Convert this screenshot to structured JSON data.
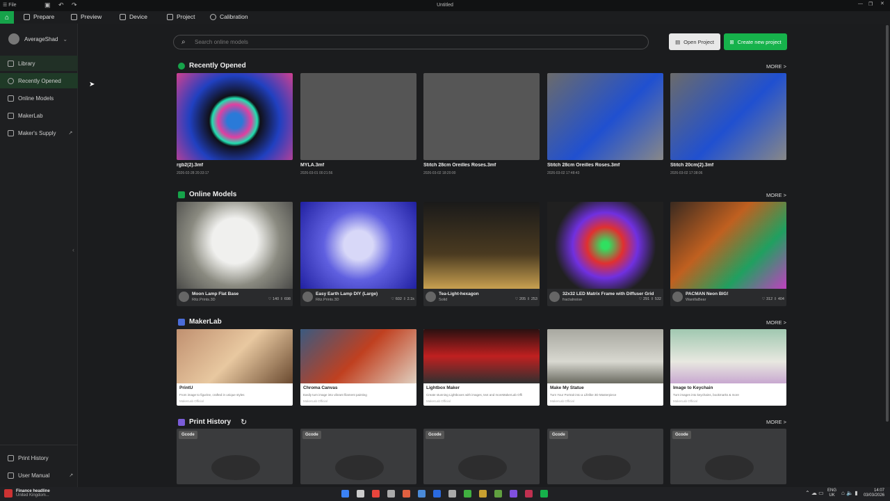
{
  "window": {
    "title": "Untitled",
    "file_menu": "File"
  },
  "menu": {
    "prepare": "Prepare",
    "preview": "Preview",
    "device": "Device",
    "project": "Project",
    "calibration": "Calibration"
  },
  "sidebar": {
    "user": "AverageShad",
    "items": [
      "Library",
      "Recently Opened",
      "Online Models",
      "MakerLab",
      "Maker's Supply"
    ],
    "bottom": [
      "Print History",
      "User Manual"
    ]
  },
  "search": {
    "placeholder": "Search online models"
  },
  "buttons": {
    "open": "Open Project",
    "create": "Create new project"
  },
  "recent": {
    "title": "Recently Opened",
    "more": "MORE >",
    "items": [
      {
        "name": "rgb2(2).3mf",
        "date": "2026-02-28 20:33:17"
      },
      {
        "name": "MYLA.3mf",
        "date": "2026-03-01 00:21:56"
      },
      {
        "name": "Stitch 28cm Oreilles Roses.3mf",
        "date": "2026-03-02 18:20:00"
      },
      {
        "name": "Stitch 28cm Oreilles Roses.3mf",
        "date": "2026-03-02 17:48:43"
      },
      {
        "name": "Stitch 20cm(2).3mf",
        "date": "2026-03-02 17:38:06"
      }
    ]
  },
  "online": {
    "title": "Online Models",
    "more": "MORE >",
    "items": [
      {
        "name": "Moon Lamp Flat Base",
        "author": "Ritz.Prints.3D",
        "likes": "140",
        "dl": "698"
      },
      {
        "name": "Easy Earth Lamp DIY (Large)",
        "author": "Ritz.Prints.3D",
        "likes": "602",
        "dl": "2.1k"
      },
      {
        "name": "Tea-Light-hexagon",
        "author": "Solid",
        "likes": "205",
        "dl": "253"
      },
      {
        "name": "32x32 LED Matrix Frame with Diffuser Grid",
        "author": "fractalnoise",
        "likes": "291",
        "dl": "532"
      },
      {
        "name": "PACMAN Neon BIG!",
        "author": "WanillaBear",
        "likes": "312",
        "dl": "404"
      }
    ]
  },
  "makerlab": {
    "title": "MakerLab",
    "more": "MORE >",
    "items": [
      {
        "name": "PrintU",
        "desc": "From image to figurine, crafted in unique styles",
        "author": "MakerLab Official"
      },
      {
        "name": "Chroma Canvas",
        "desc": "Easily turn image into vibrant filament painting",
        "author": "MakerLab Official"
      },
      {
        "name": "Lightbox Maker",
        "desc": "Create stunning Lightboxes with images, text and moreMakerLab Offi",
        "author": "MakerLab Official"
      },
      {
        "name": "Make My Statue",
        "desc": "Turn Your Portrait into a Lifelike 3D Masterpiece",
        "author": "MakerLab Official"
      },
      {
        "name": "Image to Keychain",
        "desc": "Turn images into keychains, bookmarks & more",
        "author": "MakerLab Official"
      }
    ]
  },
  "history": {
    "title": "Print History",
    "more": "MORE >",
    "badge": "Gcode"
  },
  "taskbar": {
    "news1": "Finance headline",
    "news2": "United Kingdom...",
    "lang1": "ENG",
    "lang2": "UK",
    "time": "14:07",
    "date": "03/03/2026"
  }
}
